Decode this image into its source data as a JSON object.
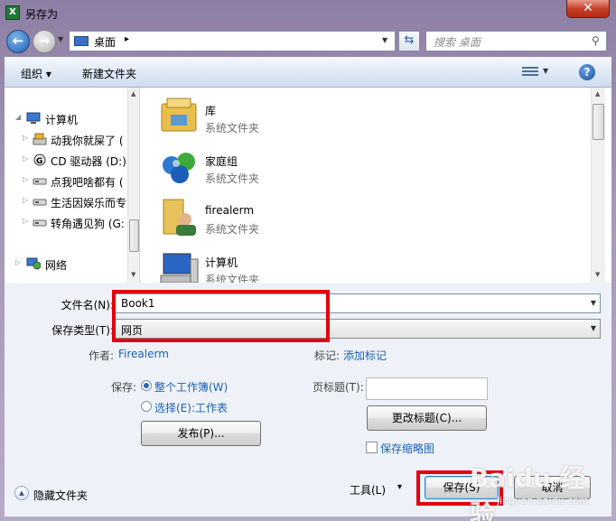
{
  "window": {
    "title": "另存为",
    "close_glyph": "✕"
  },
  "nav": {
    "address": {
      "location": "桌面",
      "separator": "▸"
    },
    "search_placeholder": "搜索 桌面"
  },
  "toolbar": {
    "organize": "组织 ▾",
    "new_folder": "新建文件夹",
    "help": "?"
  },
  "sidebar": {
    "items": [
      {
        "label": "计算机",
        "icon": "computer-icon"
      },
      {
        "label": "动我你就屎了 (",
        "icon": "drive-c-icon"
      },
      {
        "label": "CD 驱动器 (D:)",
        "icon": "cd-drive-icon"
      },
      {
        "label": "点我吧啥都有 (",
        "icon": "drive-icon"
      },
      {
        "label": "生活因娱乐而专",
        "icon": "drive-icon"
      },
      {
        "label": "转角遇见狗 (G:",
        "icon": "drive-icon"
      },
      {
        "label": "网络",
        "icon": "network-icon"
      }
    ]
  },
  "files": [
    {
      "name": "库",
      "type": "系统文件夹",
      "icon": "library-icon"
    },
    {
      "name": "家庭组",
      "type": "系统文件夹",
      "icon": "homegroup-icon"
    },
    {
      "name": "firealerm",
      "type": "系统文件夹",
      "icon": "user-folder-icon"
    },
    {
      "name": "计算机",
      "type": "系统文件夹",
      "icon": "computer-icon"
    }
  ],
  "form": {
    "filename_label": "文件名(N):",
    "filename_value": "Book1",
    "filetype_label": "保存类型(T):",
    "filetype_value": "网页",
    "author_label": "作者:",
    "author_value": "Firealerm",
    "tags_label": "标记:",
    "tags_value": "添加标记",
    "save_label": "保存:",
    "radio_workbook": "整个工作簿(W)",
    "radio_selection": "选择(E):工作表",
    "publish_button": "发布(P)...",
    "page_title_label": "页标题(T):",
    "change_title_button": "更改标题(C)...",
    "save_thumbnail": "保存缩略图"
  },
  "footer": {
    "hide_folders": "隐藏文件夹",
    "tools": "工具(L)",
    "tools_arrow": "▾",
    "save": "保存(S)",
    "cancel": "取消"
  },
  "watermark": {
    "text": "Baidu 经验",
    "sub": "jingyan.baidu.com"
  },
  "colors": {
    "highlight": "#e3000f",
    "link": "#1a5fb4",
    "accent": "#2d66b8"
  }
}
